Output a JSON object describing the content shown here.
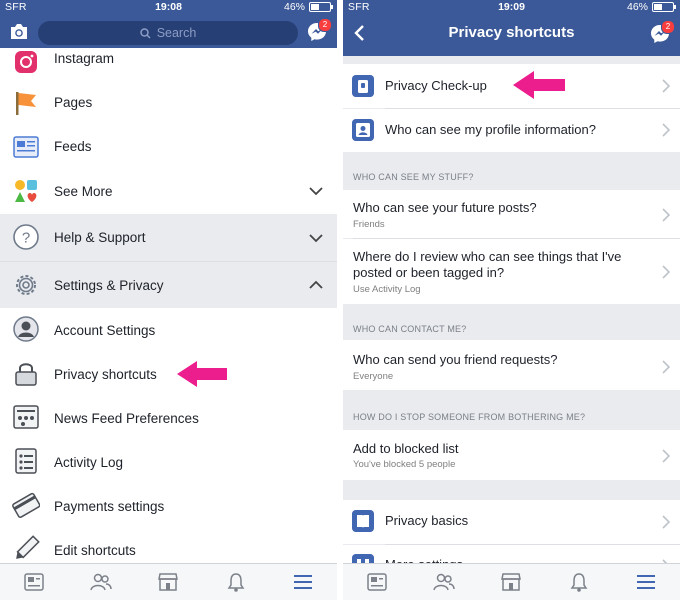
{
  "left": {
    "status": {
      "carrier": "SFR",
      "time": "19:08",
      "battery": "46%",
      "battery_level": 0.46
    },
    "search_placeholder": "Search",
    "messenger_badge": "2",
    "menu_top": [
      {
        "label": "Instagram",
        "icon": "instagram-icon"
      },
      {
        "label": "Pages",
        "icon": "flag-icon"
      },
      {
        "label": "Feeds",
        "icon": "feeds-icon"
      },
      {
        "label": "See More",
        "icon": "shapes-icon"
      }
    ],
    "help_label": "Help & Support",
    "settings_label": "Settings & Privacy",
    "submenu": [
      {
        "label": "Account Settings",
        "icon": "account-icon"
      },
      {
        "label": "Privacy shortcuts",
        "icon": "lock-icon"
      },
      {
        "label": "News Feed Preferences",
        "icon": "news-feed-icon"
      },
      {
        "label": "Activity Log",
        "icon": "activity-log-icon"
      },
      {
        "label": "Payments settings",
        "icon": "credit-card-icon"
      },
      {
        "label": "Edit shortcuts",
        "icon": "pencil-icon"
      }
    ]
  },
  "right": {
    "status": {
      "carrier": "SFR",
      "time": "19:09",
      "battery": "46%",
      "battery_level": 0.46
    },
    "title": "Privacy shortcuts",
    "messenger_badge": "2",
    "top_items": [
      {
        "label": "Privacy Check-up",
        "icon": "privacy-checkup-icon"
      },
      {
        "label": "Who can see my profile information?",
        "icon": "profile-card-icon"
      }
    ],
    "section1": {
      "header": "WHO CAN SEE MY STUFF?",
      "items": [
        {
          "title": "Who can see your future posts?",
          "sub": "Friends"
        },
        {
          "title": "Where do I review who can see things that I've posted or been tagged in?",
          "sub": "Use Activity Log"
        }
      ]
    },
    "section2": {
      "header": "WHO CAN CONTACT ME?",
      "items": [
        {
          "title": "Who can send you friend requests?",
          "sub": "Everyone"
        }
      ]
    },
    "section3": {
      "header": "HOW DO I STOP SOMEONE FROM BOTHERING ME?",
      "items": [
        {
          "title": "Add to blocked list",
          "sub": "You've blocked 5 people"
        }
      ]
    },
    "bottom_items": [
      {
        "label": "Privacy basics",
        "icon": "privacy-basics-icon"
      },
      {
        "label": "More settings",
        "icon": "more-settings-icon"
      }
    ]
  },
  "tabs": [
    "news-feed-icon",
    "friends-icon",
    "marketplace-icon",
    "notifications-icon",
    "menu-icon"
  ],
  "colors": {
    "brand": "#3b5998",
    "arrow": "#ec1d8c",
    "badge": "#fa3e3e",
    "active_tab": "#4267b2"
  }
}
